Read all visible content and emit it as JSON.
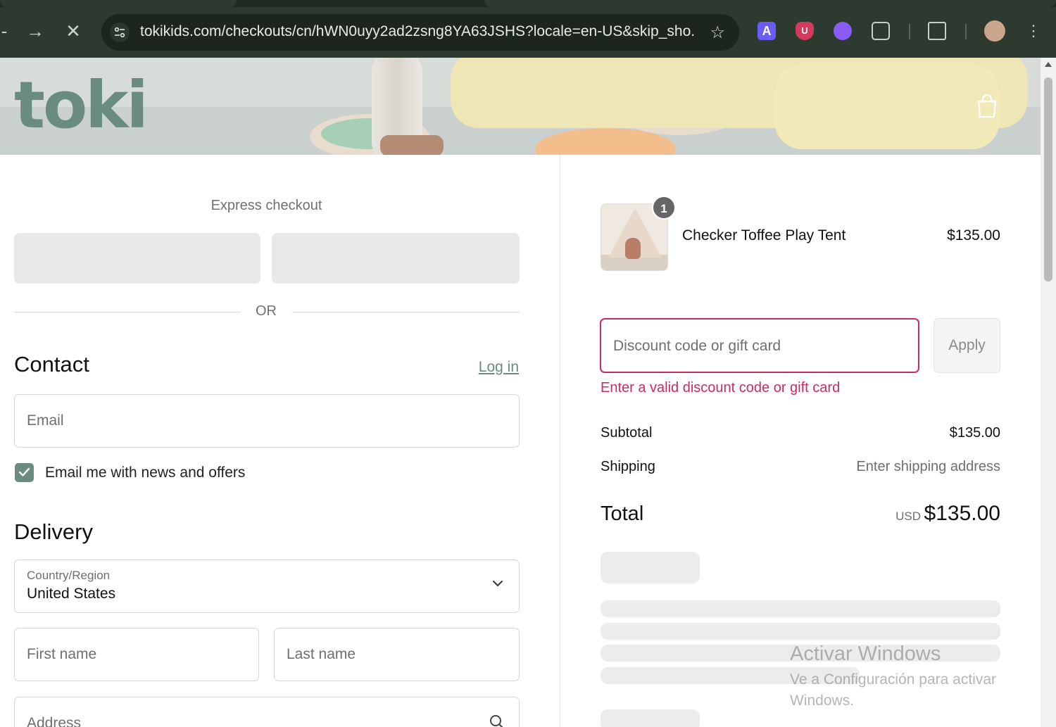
{
  "browser": {
    "url": "tokikids.com/checkouts/cn/hWN0uyy2ad2zsng8YA63JSHS?locale=en-US&skip_sho...",
    "back_icon": "arrow-left-icon",
    "forward_icon": "arrow-right-icon",
    "stop_icon": "close-icon",
    "accent_color": "#2d3a2f"
  },
  "store": {
    "logo": "toki",
    "brand_color": "#6a8b80"
  },
  "checkout": {
    "express_label": "Express checkout",
    "or_label": "OR",
    "contact": {
      "title": "Contact",
      "login": "Log in",
      "email_placeholder": "Email",
      "newsletter_label": "Email me with news and offers",
      "newsletter_checked": true
    },
    "delivery": {
      "title": "Delivery",
      "country_label": "Country/Region",
      "country_value": "United States",
      "first_name_placeholder": "First name",
      "last_name_placeholder": "Last name",
      "address_placeholder": "Address"
    }
  },
  "summary": {
    "item": {
      "name": "Checker Toffee Play Tent",
      "price": "$135.00",
      "quantity": "1"
    },
    "discount": {
      "placeholder": "Discount code or gift card",
      "apply": "Apply",
      "error": "Enter a valid discount code or gift card",
      "error_color": "#c62c66"
    },
    "subtotal_label": "Subtotal",
    "subtotal_value": "$135.00",
    "shipping_label": "Shipping",
    "shipping_value": "Enter shipping address",
    "total_label": "Total",
    "total_currency": "USD",
    "total_value": "$135.00"
  },
  "watermark": {
    "title": "Activar Windows",
    "subtitle": "Ve a Configuración para activar Windows."
  }
}
